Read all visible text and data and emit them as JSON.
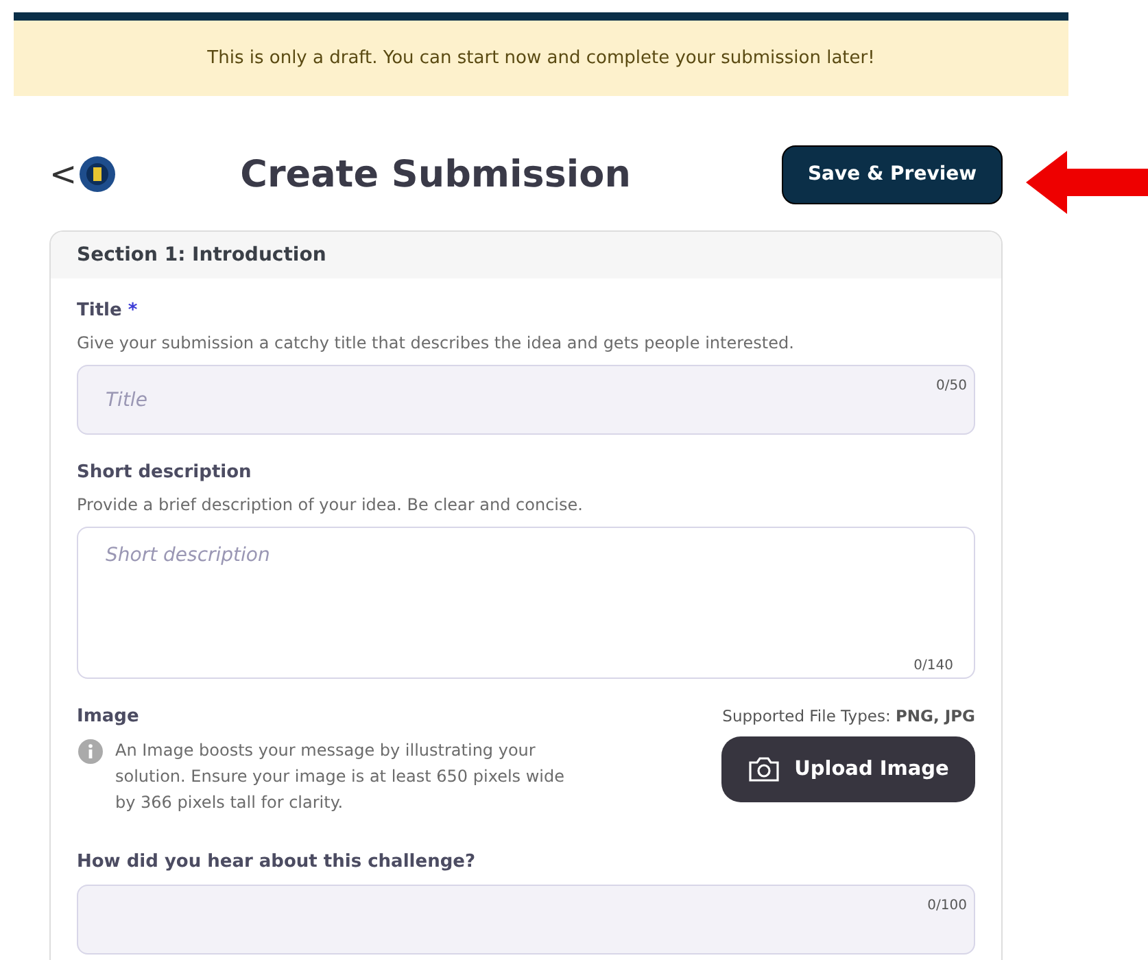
{
  "banner": {
    "text": "This is only a draft. You can start now and complete your submission later!"
  },
  "header": {
    "title": "Create Submission",
    "back": "<",
    "save_button": "Save & Preview"
  },
  "section": {
    "heading": "Section 1:  Introduction",
    "fields": [
      {
        "kind": "input",
        "label": "Title",
        "required_mark": "*",
        "hint": "Give your submission a catchy title that describes the idea and gets people interested.",
        "placeholder": "Title",
        "counter": "0/50"
      },
      {
        "kind": "textarea",
        "label": "Short description",
        "hint": "Provide a brief description of your idea. Be clear and concise.",
        "placeholder": "Short description",
        "counter": "0/140"
      },
      {
        "kind": "image",
        "label": "Image",
        "types_label": "Supported File Types: **PNG, JPG**",
        "info": "An Image boosts your message by illustrating your solution. Ensure your image is at least 650 pixels wide by 366 pixels tall for clarity.",
        "button": "Upload Image"
      },
      {
        "kind": "input",
        "label": "How did you hear about this challenge?",
        "counter": "0/100"
      }
    ]
  }
}
